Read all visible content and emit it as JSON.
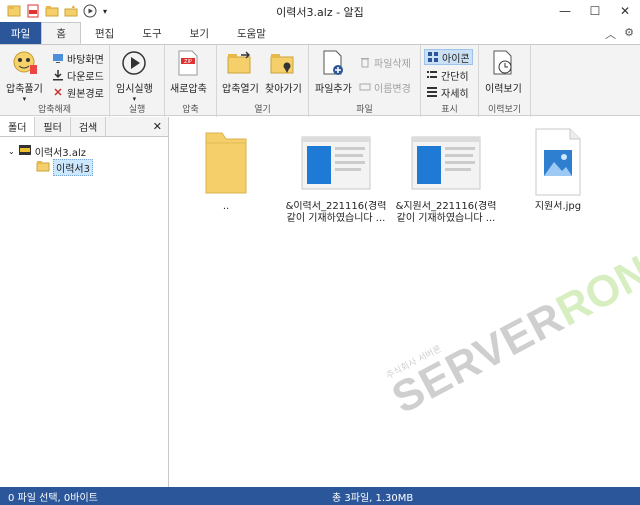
{
  "window": {
    "title": "이력서3.alz - 알집"
  },
  "tabs": {
    "file": "파일",
    "home": "홈",
    "edit": "편집",
    "tools": "도구",
    "view": "보기",
    "help": "도움말"
  },
  "ribbon": {
    "extract": {
      "label": "압축풀기",
      "group": "압축해제",
      "desktop": "바탕화면",
      "download": "다운로드",
      "original": "원본경로"
    },
    "run": {
      "label": "임시실행",
      "group": "실행"
    },
    "compress": {
      "label": "새로압축",
      "group": "압축"
    },
    "open": {
      "open_label": "압축열기",
      "find_label": "찾아가기",
      "group": "열기"
    },
    "file": {
      "add_label": "파일추가",
      "delete_label": "파일삭제",
      "rename_label": "이름변경",
      "group": "파일"
    },
    "display": {
      "icon": "아이콘",
      "simple": "간단히",
      "detail": "자세히",
      "group": "표시"
    },
    "history": {
      "label": "이력보기",
      "group": "이력보기"
    }
  },
  "panel": {
    "tabs": [
      "폴더",
      "필터",
      "검색"
    ],
    "close": "✕",
    "tree": {
      "root": "이력서3.alz",
      "child": "이력서3"
    }
  },
  "files": [
    {
      "name": "..",
      "type": "folder"
    },
    {
      "name": "&이력서_221116(경력 같이 기재하였습니다 ...",
      "type": "document"
    },
    {
      "name": "&지원서_221116(경력 같이 기재하였습니다 ...",
      "type": "document"
    },
    {
      "name": "지원서.jpg",
      "type": "image"
    }
  ],
  "watermark": {
    "small": "주식회사 서버론",
    "main": "SERVER",
    "accent": "RON"
  },
  "status": {
    "left": "0 파일 선택, 0바이트",
    "center": "총 3파일, 1.30MB"
  },
  "colors": {
    "accent": "#2b579a",
    "folder": "#f5cf6a",
    "selection": "#cce8ff"
  }
}
